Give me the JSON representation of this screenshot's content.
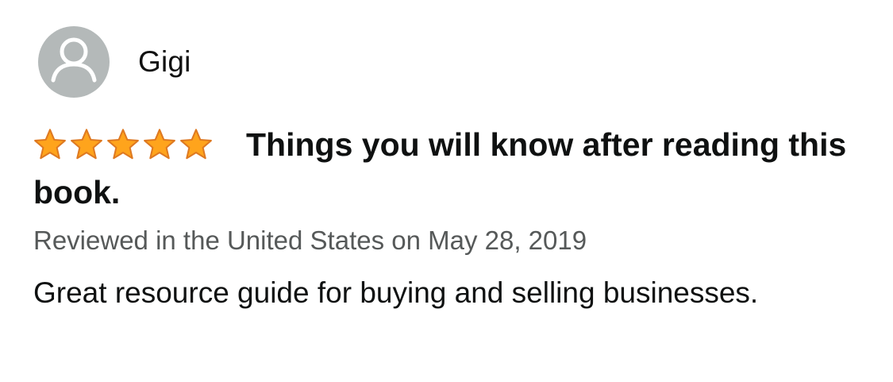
{
  "review": {
    "profile": {
      "name": "Gigi",
      "avatar_icon": "default-user-avatar-icon"
    },
    "rating": {
      "stars": 5,
      "max_stars": 5,
      "star_color": "#ffa41c",
      "star_outline_color": "#de7921"
    },
    "title": "Things you will know after reading this book.",
    "meta": "Reviewed in the United States on May 28, 2019",
    "body": "Great resource guide for buying and selling businesses."
  },
  "colors": {
    "avatar_background": "#b4b9b9",
    "meta_text": "#565959",
    "body_text": "#0f1111"
  }
}
